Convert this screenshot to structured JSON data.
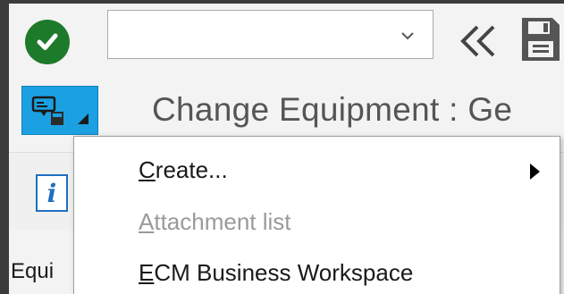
{
  "window": {
    "title": "Change Equipment : Ge"
  },
  "toolbar": {
    "command_field_value": "",
    "icons": {
      "ok": "check-circle-icon",
      "dropdown": "chevron-down-icon",
      "back": "double-chevron-left-icon",
      "save": "floppy-disk-icon"
    }
  },
  "services_menu": {
    "icon": "services-for-object-icon",
    "items": [
      {
        "first": "C",
        "rest": "reate...",
        "enabled": true,
        "has_submenu": true
      },
      {
        "first": "A",
        "rest": "ttachment list",
        "enabled": false,
        "has_submenu": false
      },
      {
        "first": "E",
        "rest": "CM Business Workspace",
        "enabled": true,
        "has_submenu": false
      }
    ]
  },
  "app_toolbar": {
    "info_glyph": "i"
  },
  "form": {
    "field_label_partial": "Equi"
  },
  "colors": {
    "accent_blue": "#1ba0e2",
    "ok_green": "#1e7a2b",
    "disabled_text": "#9a9a9a"
  }
}
